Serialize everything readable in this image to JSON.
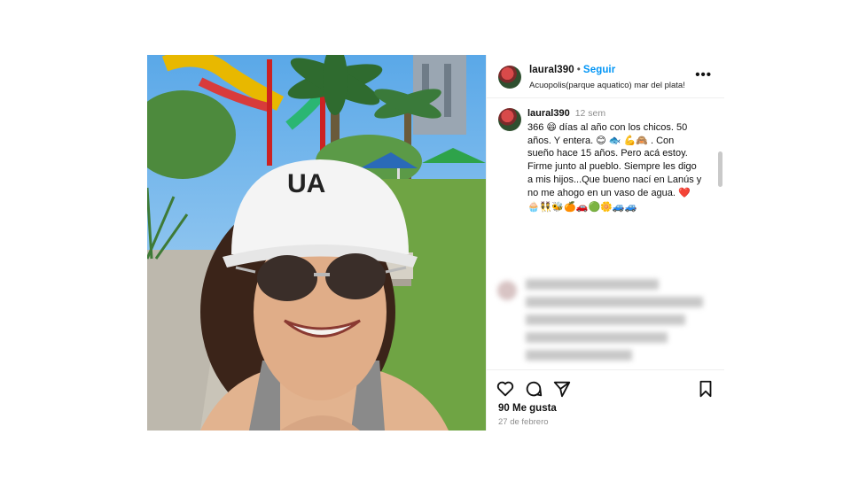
{
  "post": {
    "username": "laural390",
    "follow_label": "Seguir",
    "location": "Acuopolis(parque aquatico) mar del plata!",
    "more_label": "•••"
  },
  "caption": {
    "username": "laural390",
    "time": "12 sem",
    "lines": [
      "366 😄 días al año con los chicos. 50",
      "años. Y entera. 😊 🐟 💪🙈 . Con",
      "sueño hace 15 años. Pero acá estoy.",
      "Firme junto al pueblo. Siempre les digo",
      "a mis hijos...Que bueno nací en Lanús y",
      "no me ahogo en un vaso de agua. ❤️"
    ],
    "emoji_line": "🧁👯🐝🍊🚗🟢🌼🚙🚙"
  },
  "stats": {
    "likes": "90 Me gusta",
    "date": "27 de febrero"
  },
  "colors": {
    "accent": "#0095f6",
    "muted": "#8e8e8e"
  },
  "icons": [
    "heart-icon",
    "comment-icon",
    "share-icon",
    "bookmark-icon",
    "more-icon"
  ]
}
